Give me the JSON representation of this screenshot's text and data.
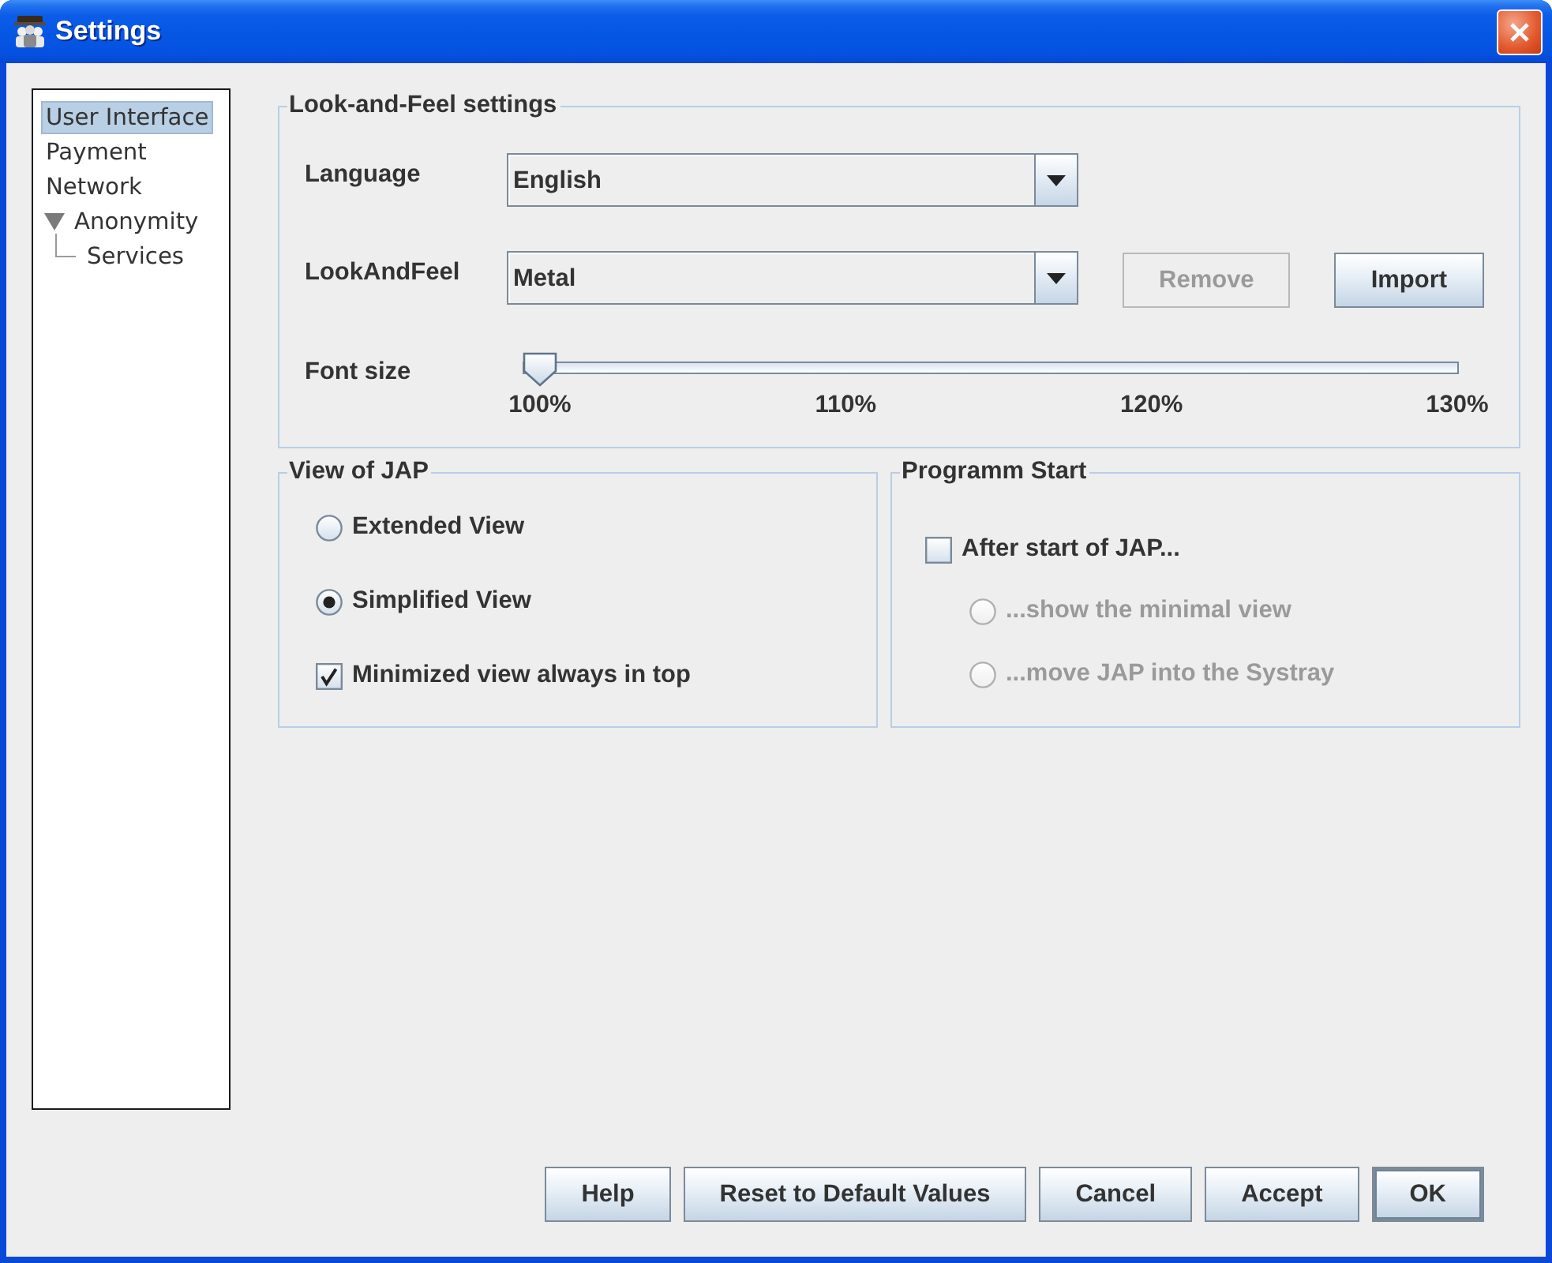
{
  "window": {
    "title": "Settings"
  },
  "tree": {
    "items": [
      {
        "label": "User Interface",
        "selected": true
      },
      {
        "label": "Payment",
        "selected": false
      },
      {
        "label": "Network",
        "selected": false
      },
      {
        "label": "Anonymity",
        "selected": false,
        "expanded": true,
        "children": [
          {
            "label": "Services",
            "selected": false
          }
        ]
      }
    ]
  },
  "look_and_feel": {
    "title": "Look-and-Feel settings",
    "language": {
      "label": "Language",
      "value": "English"
    },
    "look_and_feel": {
      "label": "LookAndFeel",
      "value": "Metal"
    },
    "buttons": [
      {
        "label": "Remove",
        "disabled": true
      },
      {
        "label": "Import",
        "disabled": false
      }
    ],
    "font_size": {
      "label": "Font size",
      "level": 0,
      "ticks": [
        "100%",
        "110%",
        "120%",
        "130%"
      ]
    }
  },
  "view_of_jap": {
    "title": "View of JAP",
    "options": [
      {
        "kind": "radio",
        "label": "Extended View",
        "selected": false
      },
      {
        "kind": "radio",
        "label": "Simplified View",
        "selected": true
      },
      {
        "kind": "checkbox",
        "label": "Minimized view always in top",
        "checked": true
      }
    ]
  },
  "programm_start": {
    "title": "Programm Start",
    "checkbox": {
      "label": "After start of JAP...",
      "checked": false
    },
    "options": [
      {
        "label": "...show the minimal view",
        "selected": false,
        "disabled": true
      },
      {
        "label": "...move JAP into the Systray",
        "selected": false,
        "disabled": true
      }
    ]
  },
  "buttons": [
    {
      "label": "Help",
      "default": false
    },
    {
      "label": "Reset to Default Values",
      "default": false
    },
    {
      "label": "Cancel",
      "default": false
    },
    {
      "label": "Accept",
      "default": false
    },
    {
      "label": "OK",
      "default": true
    }
  ]
}
